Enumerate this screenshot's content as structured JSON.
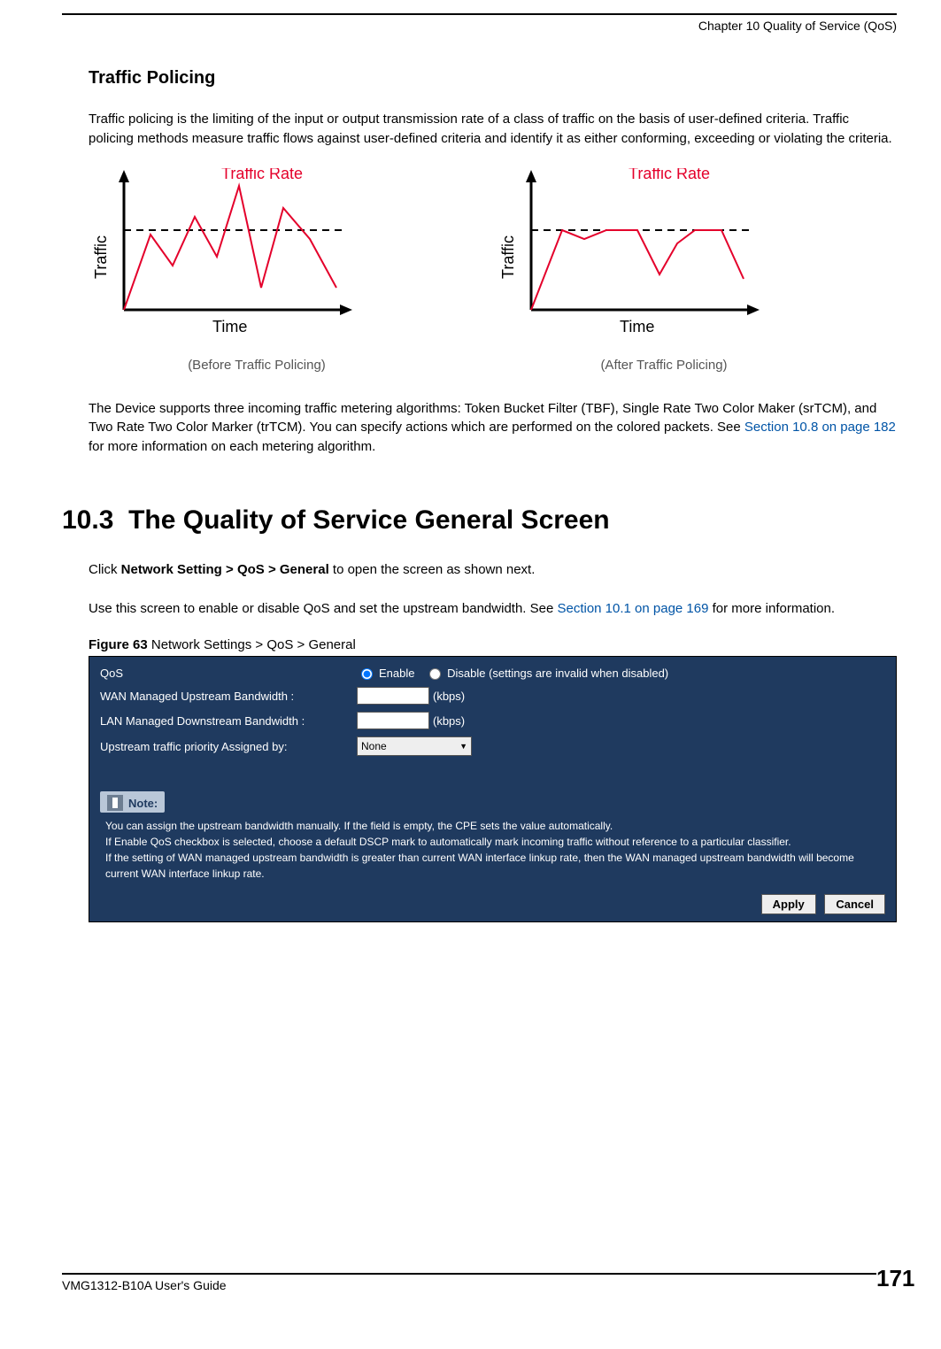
{
  "header": {
    "chapter": "Chapter 10 Quality of Service (QoS)"
  },
  "section1": {
    "heading": "Traffic Policing",
    "para1": "Traffic policing is the limiting of the input or output transmission rate of a class of traffic on the basis of user-defined criteria. Traffic policing methods measure traffic flows against user-defined criteria and identify it as either conforming, exceeding or violating the criteria.",
    "diagram": {
      "yLabel": "Traffic",
      "xLabel": "Time",
      "rateLabel": "Traffic Rate",
      "captionBefore": "(Before Traffic Policing)",
      "captionAfter": "(After Traffic Policing)"
    },
    "para2_a": "The Device supports three incoming traffic metering algorithms: Token Bucket Filter (TBF), Single Rate Two Color Maker (srTCM), and Two Rate Two Color Marker (trTCM). You can specify actions which are performed on the colored packets. See ",
    "para2_link": "Section 10.8 on page 182",
    "para2_b": " for more information on each metering algorithm."
  },
  "section2": {
    "number": "10.3",
    "title": "The Quality of Service General Screen",
    "para1_a": "Click ",
    "para1_bold": "Network Setting > QoS > General",
    "para1_b": " to open the screen as shown next.",
    "para2_a": "Use this screen to enable or disable QoS and set the upstream bandwidth. See ",
    "para2_link": "Section 10.1 on page 169",
    "para2_b": " for more information.",
    "figureLabelBold": "Figure 63",
    "figureLabelRest": "   Network Settings > QoS > General"
  },
  "screenshot": {
    "rows": {
      "qos": {
        "label": "QoS",
        "enable": "Enable",
        "disable": "Disable (settings are invalid when disabled)"
      },
      "wan": {
        "label": "WAN Managed Upstream Bandwidth :",
        "unit": "(kbps)"
      },
      "lan": {
        "label": "LAN Managed Downstream Bandwidth :",
        "unit": "(kbps)"
      },
      "priority": {
        "label": "Upstream traffic priority Assigned by:",
        "value": "None"
      }
    },
    "note": {
      "title": "Note:",
      "line1": "You can assign the upstream bandwidth manually. If the field is empty, the CPE sets the value automatically.",
      "line2": "If Enable QoS checkbox is selected, choose a default DSCP mark to automatically mark incoming traffic without reference to a particular classifier.",
      "line3": "If the setting of WAN managed upstream bandwidth is greater than current WAN interface linkup rate, then the WAN managed upstream bandwidth will become current WAN interface linkup rate."
    },
    "buttons": {
      "apply": "Apply",
      "cancel": "Cancel"
    }
  },
  "footer": {
    "guide": "VMG1312-B10A User's Guide",
    "page": "171"
  },
  "chart_data": [
    {
      "type": "line",
      "title": "Before Traffic Policing",
      "xlabel": "Time",
      "ylabel": "Traffic",
      "series": [
        {
          "name": "Traffic",
          "x": [
            0,
            1,
            2,
            3,
            4,
            5,
            6,
            7,
            8,
            9
          ],
          "values": [
            0,
            55,
            35,
            70,
            40,
            95,
            25,
            80,
            60,
            30
          ]
        },
        {
          "name": "Traffic Rate",
          "x": [
            0,
            9
          ],
          "values": [
            55,
            55
          ]
        }
      ],
      "ylim": [
        0,
        100
      ]
    },
    {
      "type": "line",
      "title": "After Traffic Policing",
      "xlabel": "Time",
      "ylabel": "Traffic",
      "series": [
        {
          "name": "Traffic",
          "x": [
            0,
            1,
            2,
            3,
            4,
            5,
            6,
            7,
            8,
            9
          ],
          "values": [
            0,
            55,
            50,
            55,
            55,
            30,
            50,
            55,
            55,
            30
          ]
        },
        {
          "name": "Traffic Rate",
          "x": [
            0,
            9
          ],
          "values": [
            55,
            55
          ]
        }
      ],
      "ylim": [
        0,
        100
      ]
    }
  ]
}
